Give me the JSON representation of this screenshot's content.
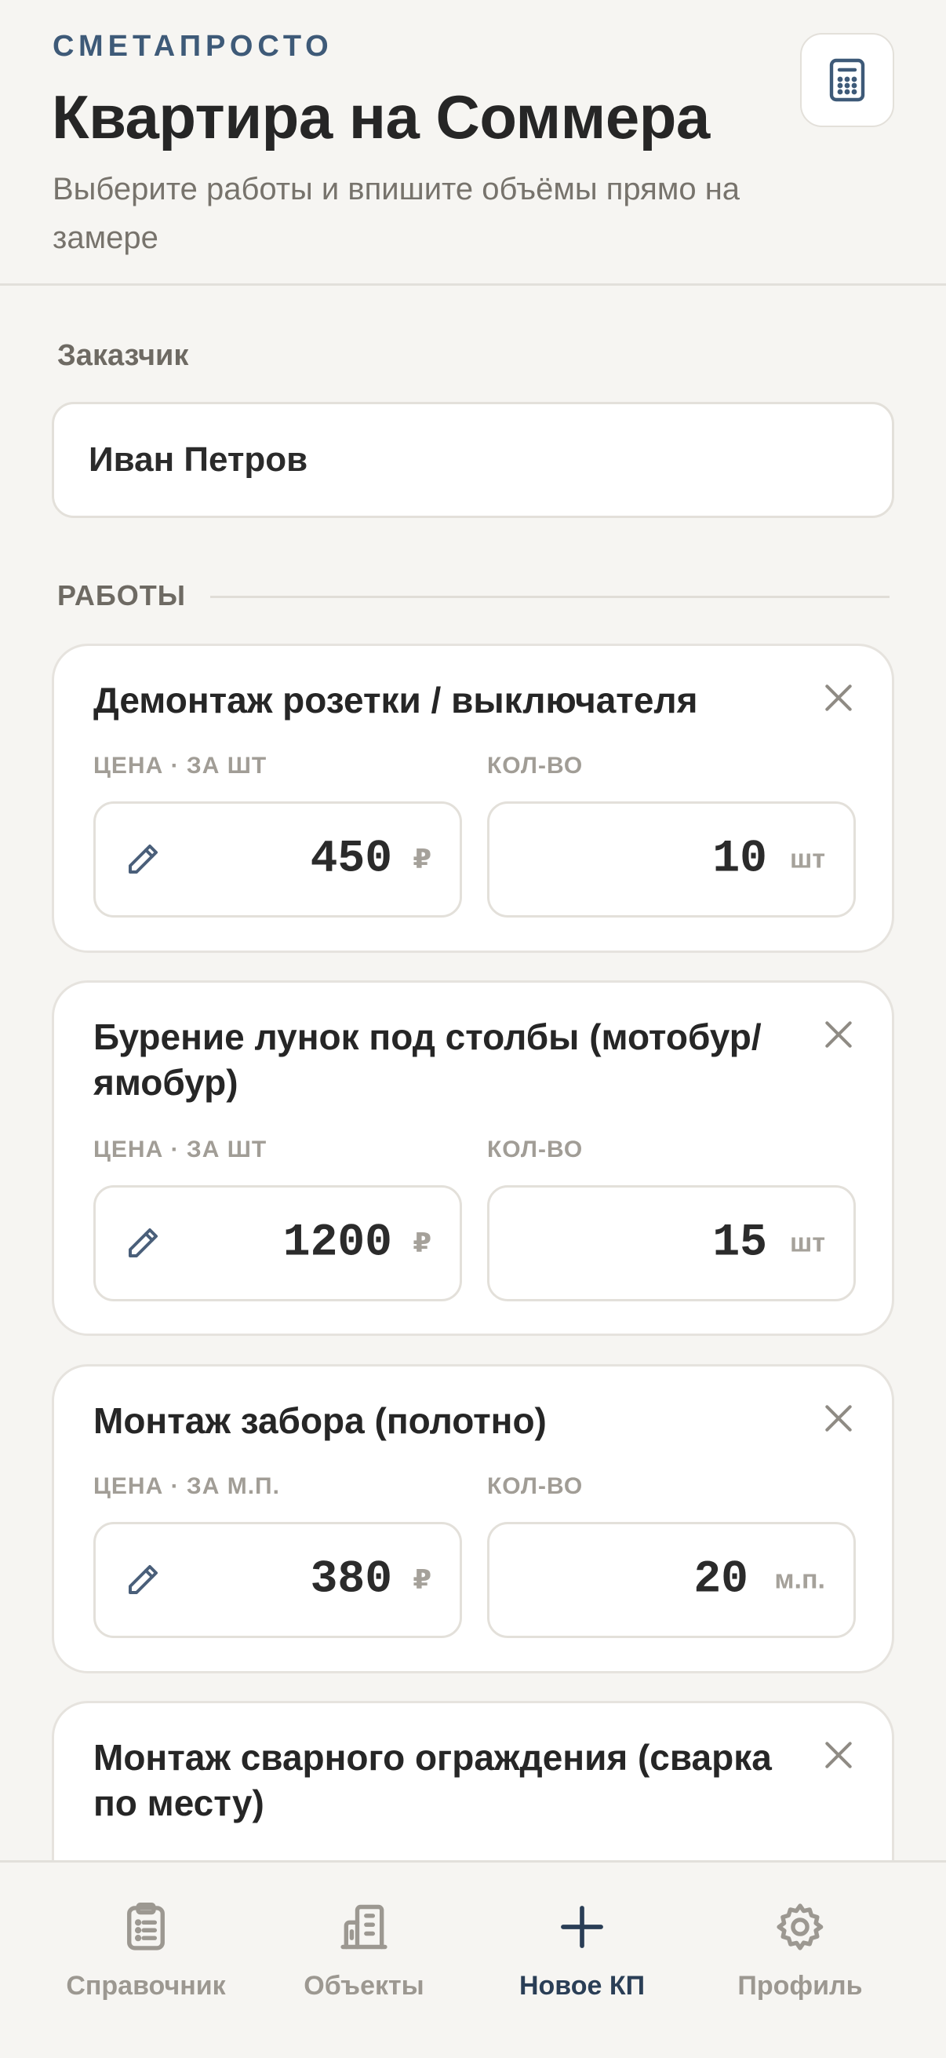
{
  "header": {
    "brand": "СМЕТАПРОСТО",
    "title": "Квартира на Соммера",
    "subtitle": "Выберите работы и впишите объёмы прямо на замере"
  },
  "customer": {
    "label": "Заказчик",
    "value": "Иван Петров"
  },
  "works": {
    "section_title": "РАБОТЫ",
    "items": [
      {
        "title": "Демонтаж розетки / выключателя",
        "price_label": "ЦЕНА · ЗА ШТ",
        "qty_label": "КОЛ-ВО",
        "price": "450",
        "currency": "₽",
        "qty": "10",
        "unit": "шт"
      },
      {
        "title": "Бурение лунок под столбы (мотобур/ямобур)",
        "price_label": "ЦЕНА · ЗА ШТ",
        "qty_label": "КОЛ-ВО",
        "price": "1200",
        "currency": "₽",
        "qty": "15",
        "unit": "шт"
      },
      {
        "title": "Монтаж забора (полотно)",
        "price_label": "ЦЕНА · ЗА М.П.",
        "qty_label": "КОЛ-ВО",
        "price": "380",
        "currency": "₽",
        "qty": "20",
        "unit": "м.п."
      },
      {
        "title": "Монтаж сварного ограждения (сварка по месту)"
      }
    ]
  },
  "tabbar": {
    "tabs": [
      {
        "label": "Справочник",
        "icon": "clipboard-icon"
      },
      {
        "label": "Объекты",
        "icon": "building-icon"
      },
      {
        "label": "Новое КП",
        "icon": "plus-icon",
        "active": true
      },
      {
        "label": "Профиль",
        "icon": "gear-icon"
      }
    ]
  },
  "colors": {
    "background": "#f6f5f2",
    "brand": "#3e5a78",
    "active_tab": "#2a3e56",
    "muted": "#9c9891"
  }
}
